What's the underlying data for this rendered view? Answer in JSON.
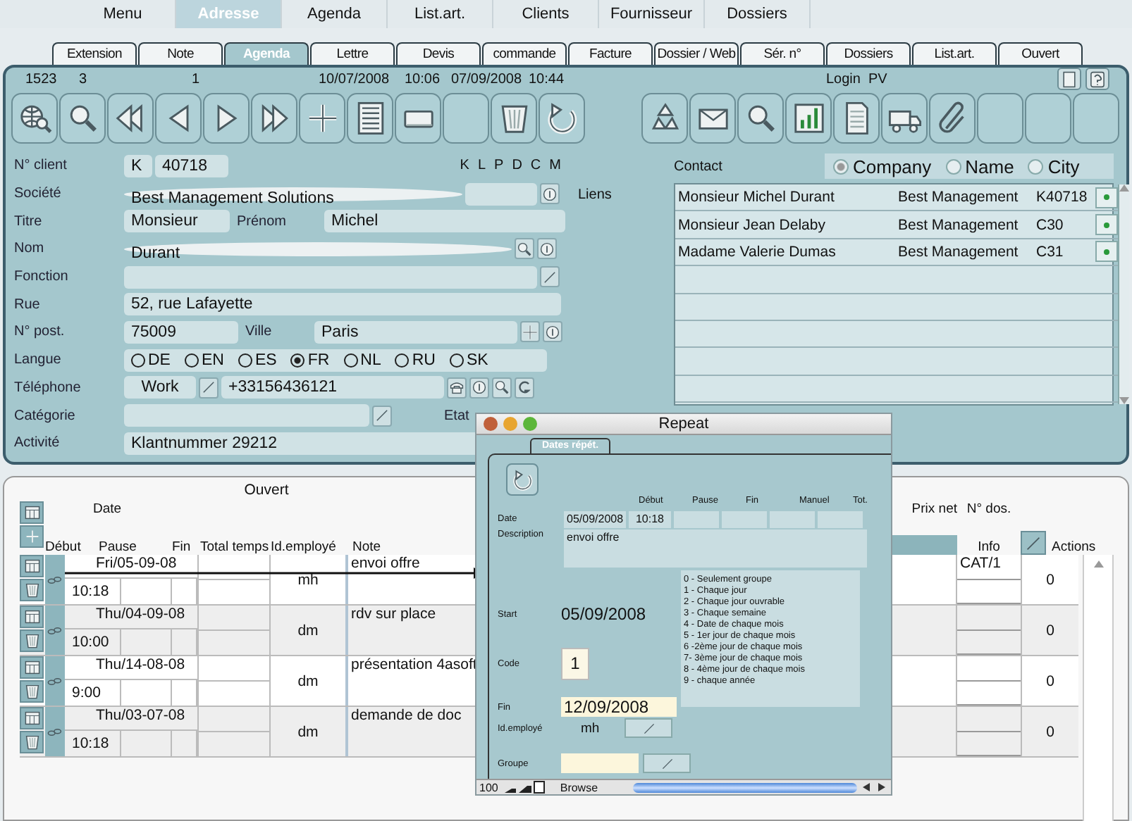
{
  "menu_tabs": [
    {
      "label": "Menu",
      "selected": false
    },
    {
      "label": "Adresse",
      "selected": true
    },
    {
      "label": "Agenda",
      "selected": false
    },
    {
      "label": "List.art.",
      "selected": false
    },
    {
      "label": "Clients",
      "selected": false
    },
    {
      "label": "Fournisseur",
      "selected": false
    },
    {
      "label": "Dossiers",
      "selected": false
    }
  ],
  "tabs": [
    {
      "label": "Extension",
      "selected": false
    },
    {
      "label": "Note",
      "selected": false
    },
    {
      "label": "Agenda",
      "selected": true
    },
    {
      "label": "Lettre",
      "selected": false
    },
    {
      "label": "Devis",
      "selected": false
    },
    {
      "label": "commande",
      "selected": false
    },
    {
      "label": "Facture",
      "selected": false
    },
    {
      "label": "Dossier / Web",
      "selected": false
    },
    {
      "label": "Sér. n°",
      "selected": false
    },
    {
      "label": "Dossiers",
      "selected": false
    },
    {
      "label": "List.art.",
      "selected": false
    },
    {
      "label": "Ouvert",
      "selected": false
    }
  ],
  "header": {
    "record": "1523",
    "count": "3",
    "page": "1",
    "created_date": "10/07/2008",
    "created_time": "10:06",
    "modified_date": "07/09/2008",
    "modified_time": "10:44",
    "login_label": "Login",
    "login_user": "PV"
  },
  "form": {
    "client_no": {
      "label": "N° client",
      "prefix": "K",
      "value": "40718",
      "flags": [
        "K",
        "L",
        "P",
        "D",
        "C",
        "M"
      ]
    },
    "company": {
      "label": "Société",
      "value": "Best Management Solutions"
    },
    "title": {
      "label": "Titre",
      "value": "Monsieur",
      "first_name_label": "Prénom",
      "first_name": "Michel"
    },
    "last_name": {
      "label": "Nom",
      "value": "Durant"
    },
    "function": {
      "label": "Fonction"
    },
    "street": {
      "label": "Rue",
      "value": "52, rue Lafayette"
    },
    "postcode": {
      "label": "N° post.",
      "value": "75009",
      "city_label": "Ville",
      "city": "Paris"
    },
    "language": {
      "label": "Langue",
      "options": [
        {
          "label": "DE",
          "selected": false
        },
        {
          "label": "EN",
          "selected": false
        },
        {
          "label": "ES",
          "selected": false
        },
        {
          "label": "FR",
          "selected": true
        },
        {
          "label": "NL",
          "selected": false
        },
        {
          "label": "RU",
          "selected": false
        },
        {
          "label": "SK",
          "selected": false
        }
      ]
    },
    "phone": {
      "label": "Téléphone",
      "type": "Work",
      "value": "+33156436121"
    },
    "category": {
      "label": "Catégorie",
      "state_label": "Etat"
    },
    "activity": {
      "label": "Activité",
      "value": "Klantnummer 29212"
    }
  },
  "contacts": {
    "label": "Contact",
    "search_by": [
      {
        "label": "Company",
        "selected": true
      },
      {
        "label": "Name",
        "selected": false
      },
      {
        "label": "City",
        "selected": false
      }
    ],
    "links_label": "Liens",
    "rows": [
      {
        "name": "Monsieur Michel Durant",
        "company": "Best Management",
        "code": "K40718"
      },
      {
        "name": "Monsieur Jean Delaby",
        "company": "Best Management",
        "code": "C30"
      },
      {
        "name": "Madame Valerie Dumas",
        "company": "Best Management",
        "code": "C31"
      }
    ]
  },
  "agenda": {
    "title": "Ouvert",
    "columns": {
      "date": "Date",
      "start": "Début",
      "pause": "Pause",
      "end": "Fin",
      "total": "Total temps",
      "employee": "Id.employé",
      "note": "Note",
      "net_price": "Prix net",
      "file_no": "N° dos.",
      "info": "Info",
      "actions": "Actions"
    },
    "rows": [
      {
        "date": "Fri/05-09-08",
        "start": "10:18",
        "employee": "mh",
        "note": "envoi offre",
        "info": "CAT/1",
        "actions": "0"
      },
      {
        "date": "Thu/04-09-08",
        "start": "10:00",
        "employee": "dm",
        "note": "rdv sur place",
        "actions": "0"
      },
      {
        "date": "Thu/14-08-08",
        "start": "9:00",
        "employee": "dm",
        "note": "présentation 4asoft",
        "actions": "0"
      },
      {
        "date": "Thu/03-07-08",
        "start": "10:18",
        "employee": "dm",
        "note": "demande de doc",
        "actions": "0"
      }
    ]
  },
  "repeat_window": {
    "title": "Repeat",
    "tab": "Dates répét.",
    "columns": [
      "Début",
      "Pause",
      "Fin",
      "Manuel",
      "Tot."
    ],
    "date_label": "Date",
    "date": "05/09/2008",
    "time": "10:18",
    "description_label": "Description",
    "description": "envoi offre",
    "codes": [
      "0 - Seulement groupe",
      "1 - Chaque jour",
      "2 - Chaque jour ouvrable",
      "3 - Chaque semaine",
      "4 - Date de chaque mois",
      "5 - 1er jour de chaque mois",
      "6 -2ème jour de chaque mois",
      "7- 3ème jour de chaque mois",
      "8 - 4ème jour de chaque mois",
      "9 - chaque année"
    ],
    "start_label": "Start",
    "start": "05/09/2008",
    "code_label": "Code",
    "code": "1",
    "end_label": "Fin",
    "end": "12/09/2008",
    "employee_label": "Id.employé",
    "employee": "mh",
    "group_label": "Groupe",
    "zoom": "100",
    "mode": "Browse"
  }
}
